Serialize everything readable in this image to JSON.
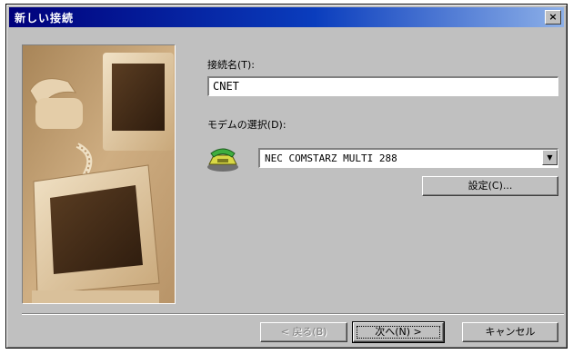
{
  "window": {
    "title": "新しい接続",
    "close_label": "×"
  },
  "form": {
    "connection_name_label": "接続名(T):",
    "connection_name_value": "CNET",
    "modem_select_label": "モデムの選択(D):",
    "modem_selected": "NEC COMSTARZ MULTI 288",
    "configure_label": "設定(C)..."
  },
  "buttons": {
    "back_label": "< 戻る(B)",
    "next_label": "次へ(N) >",
    "cancel_label": "キャンセル"
  },
  "icons": {
    "modem": "modem-phone-icon",
    "dropdown": "chevron-down-icon",
    "close": "close-icon"
  },
  "colors": {
    "title_bar_start": "#00007b",
    "title_bar_end": "#8db0e8",
    "dialog_face": "#c0c0c0",
    "illustration_tint": "#c9a87c"
  }
}
